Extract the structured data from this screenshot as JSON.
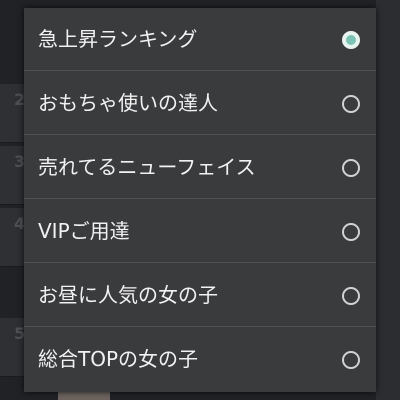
{
  "background_list": {
    "rank_numbers": [
      "2",
      "3",
      "4",
      "5"
    ]
  },
  "dialog": {
    "options": [
      {
        "label": "急上昇ランキング",
        "selected": true
      },
      {
        "label": "おもちゃ使いの達人",
        "selected": false
      },
      {
        "label": "売れてるニューフェイス",
        "selected": false
      },
      {
        "label": "VIPご用達",
        "selected": false
      },
      {
        "label": "お昼に人気の女の子",
        "selected": false
      },
      {
        "label": "総合TOPの女の子",
        "selected": false
      }
    ]
  },
  "colors": {
    "accent": "#7bc4b3",
    "dialog_background": "#3a3b3d",
    "divider": "#505153",
    "text": "#f2f2f2"
  }
}
